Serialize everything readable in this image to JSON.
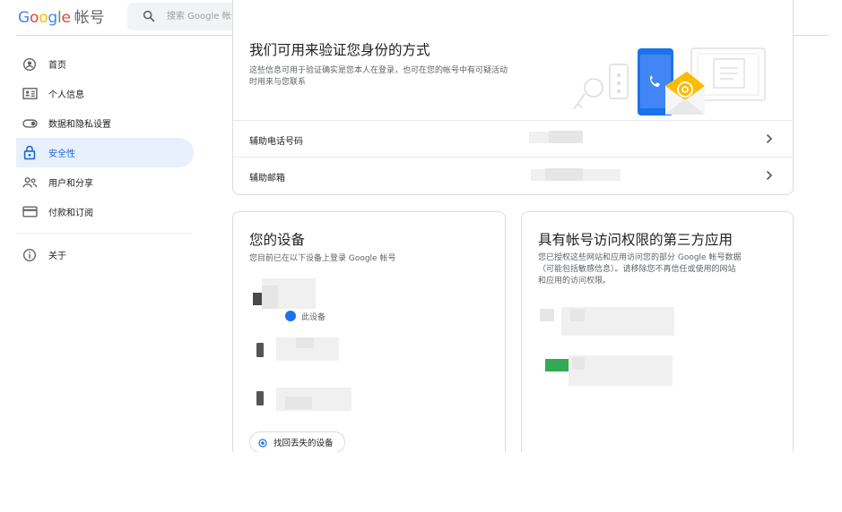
{
  "header": {
    "logo_parts": [
      "G",
      "o",
      "o",
      "g",
      "l",
      "e"
    ],
    "logo_suffix": "帐号",
    "search_placeholder": "搜索 Google 帐号"
  },
  "sidebar": {
    "items": [
      {
        "label": "首页",
        "icon": "account-circle-icon"
      },
      {
        "label": "个人信息",
        "icon": "id-card-icon"
      },
      {
        "label": "数据和隐私设置",
        "icon": "toggle-icon"
      },
      {
        "label": "安全性",
        "icon": "lock-icon",
        "active": true
      },
      {
        "label": "用户和分享",
        "icon": "people-icon"
      },
      {
        "label": "付款和订阅",
        "icon": "credit-card-icon"
      },
      {
        "label": "关于",
        "icon": "info-icon"
      }
    ]
  },
  "verify_card": {
    "title": "我们可用来验证您身份的方式",
    "desc_line1": "这些信息可用于验证确实是您本人在登录，也可在您的帐号中有可疑活动",
    "desc_line2": "时用来与您联系",
    "rows": [
      {
        "label": "辅助电话号码"
      },
      {
        "label": "辅助邮箱"
      }
    ]
  },
  "devices_card": {
    "title": "您的设备",
    "desc": "您目前已在以下设备上登录 Google 帐号",
    "current_device_badge": "此设备",
    "find_button": "找回丢失的设备"
  },
  "apps_card": {
    "title": "具有帐号访问权限的第三方应用",
    "desc_line1": "您已授权这些网站和应用访问您的部分 Google 帐号数据",
    "desc_line2": "（可能包括敏感信息）。请移除您不再信任或使用的网站",
    "desc_line3": "和应用的访问权限。"
  },
  "colors": {
    "accent": "#1a73e8",
    "active_bg": "#e8f0fe",
    "border": "#dadce0"
  }
}
